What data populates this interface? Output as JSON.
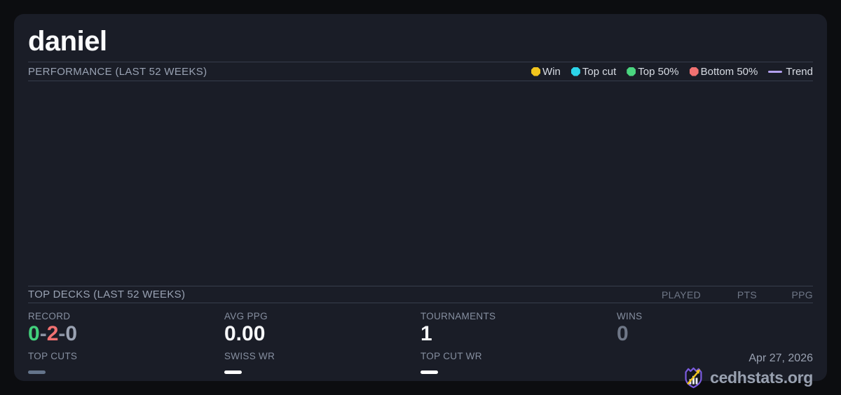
{
  "page": {
    "background": "#0c0d10",
    "card_background": "#1a1d27"
  },
  "player": {
    "name": "daniel"
  },
  "performance": {
    "title": "PERFORMANCE (LAST 52 WEEKS)",
    "legend": [
      {
        "label": "Win",
        "color": "#f2c51d",
        "marker": "dot"
      },
      {
        "label": "Top cut",
        "color": "#2cd4e9",
        "marker": "dot"
      },
      {
        "label": "Top 50%",
        "color": "#4ad57f",
        "marker": "dot"
      },
      {
        "label": "Bottom 50%",
        "color": "#f17171",
        "marker": "dot"
      },
      {
        "label": "Trend",
        "color": "#b3a0ee",
        "marker": "line"
      }
    ],
    "chart": {
      "type": "scatter",
      "points": []
    }
  },
  "top_decks": {
    "title": "TOP DECKS (LAST 52 WEEKS)",
    "columns": [
      "PLAYED",
      "PTS",
      "PPG"
    ],
    "rows": []
  },
  "stats": {
    "record": {
      "label": "RECORD",
      "wins": "0",
      "losses": "2",
      "draws": "0",
      "separator": "-",
      "wins_color": "#42d07c",
      "losses_color": "#f17171",
      "draws_color": "#9aa2b2",
      "separator_color": "#8b93a3"
    },
    "avg_ppg": {
      "label": "AVG PPG",
      "value": "0.00"
    },
    "tournaments": {
      "label": "TOURNAMENTS",
      "value": "1"
    },
    "wins": {
      "label": "WINS",
      "value": "0",
      "value_color": "#6f7787"
    },
    "top_cuts": {
      "label": "TOP CUTS",
      "placeholder": "—",
      "dash_color": "#64748b"
    },
    "swiss_wr": {
      "label": "SWISS WR",
      "placeholder": "—",
      "dash_color": "#ffffff"
    },
    "top_cut_wr": {
      "label": "TOP CUT WR",
      "placeholder": "—",
      "dash_color": "#ffffff"
    }
  },
  "footer": {
    "date": "Apr 27, 2026",
    "brand": "cedhstats.org",
    "logo_purple": "#7c5ce0",
    "logo_gold": "#f2c51d"
  }
}
